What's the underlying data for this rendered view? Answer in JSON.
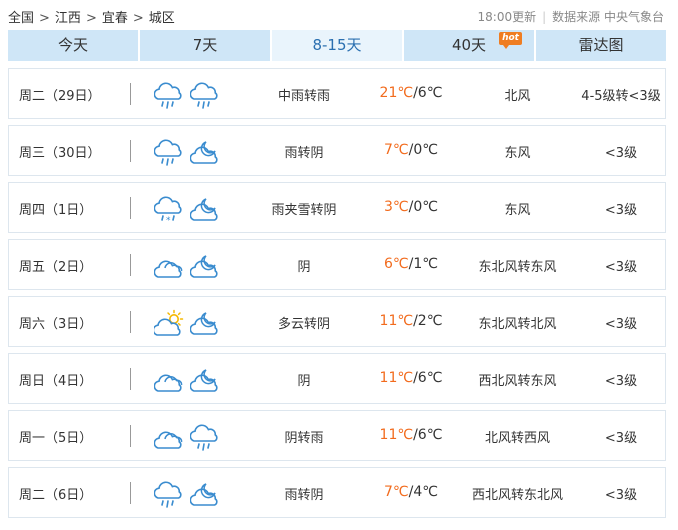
{
  "breadcrumb": [
    "全国",
    "江西",
    "宜春",
    "城区"
  ],
  "meta": {
    "update": "18:00更新",
    "source": "数据来源 中央气象台"
  },
  "tabs": [
    {
      "label": "今天",
      "active": false
    },
    {
      "label": "7天",
      "active": false
    },
    {
      "label": "8-15天",
      "active": true
    },
    {
      "label": "40天",
      "active": false,
      "badge": "hot"
    },
    {
      "label": "雷达图",
      "active": false
    }
  ],
  "colors": {
    "tab_bg": "#cfe6f7",
    "tab_active_bg": "#e9f4fc",
    "high_temp": "#f26b1d",
    "icon_stroke": "#3a8ccf",
    "sun": "#f5b800"
  },
  "forecast": [
    {
      "date": "周二（29日）",
      "icon_day": "rain-cloud-icon",
      "icon_night": "rain-cloud-icon",
      "desc": "中雨转雨",
      "high": "21℃",
      "low": "/6℃",
      "wind": "北风",
      "level": "4-5级转<3级"
    },
    {
      "date": "周三（30日）",
      "icon_day": "rain-cloud-icon",
      "icon_night": "cloudy-moon-icon",
      "desc": "雨转阴",
      "high": "7℃",
      "low": "/0℃",
      "wind": "东风",
      "level": "<3级"
    },
    {
      "date": "周四（1日）",
      "icon_day": "sleet-cloud-icon",
      "icon_night": "cloudy-moon-icon",
      "desc": "雨夹雪转阴",
      "high": "3℃",
      "low": "/0℃",
      "wind": "东风",
      "level": "<3级"
    },
    {
      "date": "周五（2日）",
      "icon_day": "overcast-icon",
      "icon_night": "cloudy-moon-icon",
      "desc": "阴",
      "high": "6℃",
      "low": "/1℃",
      "wind": "东北风转东风",
      "level": "<3级"
    },
    {
      "date": "周六（3日）",
      "icon_day": "partly-cloudy-sun-icon",
      "icon_night": "cloudy-moon-icon",
      "desc": "多云转阴",
      "high": "11℃",
      "low": "/2℃",
      "wind": "东北风转北风",
      "level": "<3级"
    },
    {
      "date": "周日（4日）",
      "icon_day": "overcast-icon",
      "icon_night": "cloudy-moon-icon",
      "desc": "阴",
      "high": "11℃",
      "low": "/6℃",
      "wind": "西北风转东风",
      "level": "<3级"
    },
    {
      "date": "周一（5日）",
      "icon_day": "overcast-icon",
      "icon_night": "rain-cloud-icon",
      "desc": "阴转雨",
      "high": "11℃",
      "low": "/6℃",
      "wind": "北风转西风",
      "level": "<3级"
    },
    {
      "date": "周二（6日）",
      "icon_day": "rain-cloud-icon",
      "icon_night": "cloudy-moon-icon",
      "desc": "雨转阴",
      "high": "7℃",
      "low": "/4℃",
      "wind": "西北风转东北风",
      "level": "<3级"
    }
  ]
}
